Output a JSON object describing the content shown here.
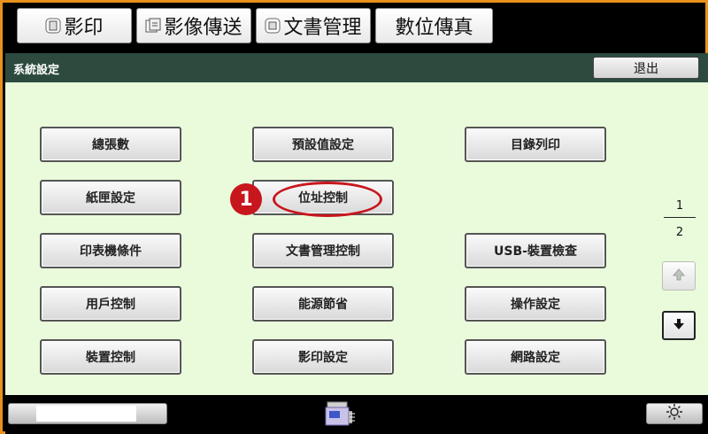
{
  "tabs": [
    {
      "label": "影印",
      "icon": "copy-icon"
    },
    {
      "label": "影像傳送",
      "icon": "image-send-icon"
    },
    {
      "label": "文書管理",
      "icon": "document-filing-icon"
    },
    {
      "label": "數位傳真",
      "icon": null
    }
  ],
  "titlebar": {
    "title": "系統設定",
    "exit_label": "退出"
  },
  "menu": {
    "col1": [
      "總張數",
      "紙匣設定",
      "印表機條件",
      "用戶控制",
      "裝置控制"
    ],
    "col2": [
      "預設值設定",
      "位址控制",
      "文書管理控制",
      "能源節省",
      "影印設定"
    ],
    "col3": [
      "目錄列印",
      "USB-裝置檢查",
      "操作設定",
      "網路設定"
    ]
  },
  "callout": {
    "number": "1",
    "color": "#c8161d"
  },
  "pager": {
    "current": "1",
    "total": "2"
  },
  "colors": {
    "frame": "#e8911c",
    "titlebar": "#2c4b3e",
    "panel": "#eafbdc"
  }
}
